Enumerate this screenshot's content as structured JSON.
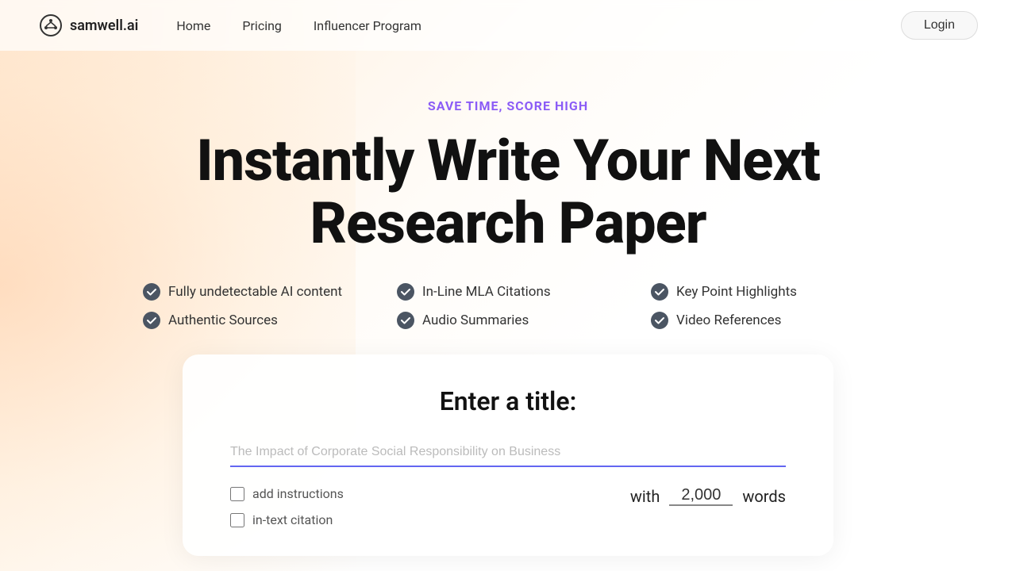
{
  "brand": {
    "name": "samwell.ai",
    "logo_alt": "samwell logo"
  },
  "nav": {
    "links": [
      {
        "label": "Home",
        "id": "home"
      },
      {
        "label": "Pricing",
        "id": "pricing"
      },
      {
        "label": "Influencer Program",
        "id": "influencer"
      }
    ],
    "login_label": "Login"
  },
  "hero": {
    "tagline": "SAVE TIME, SCORE HIGH",
    "title_line1": "Instantly Write Your Next",
    "title_line2": "Research Paper"
  },
  "features": [
    {
      "label": "Fully undetectable AI content",
      "id": "feat-undetectable"
    },
    {
      "label": "In-Line MLA Citations",
      "id": "feat-citations"
    },
    {
      "label": "Key Point Highlights",
      "id": "feat-highlights"
    },
    {
      "label": "Authentic Sources",
      "id": "feat-sources"
    },
    {
      "label": "Audio Summaries",
      "id": "feat-audio"
    },
    {
      "label": "Video References",
      "id": "feat-video"
    }
  ],
  "card": {
    "title": "Enter a title:",
    "input_placeholder": "The Impact of Corporate Social Responsibility on Business",
    "options": [
      {
        "label": "add instructions",
        "id": "opt-instructions"
      },
      {
        "label": "in-text citation",
        "id": "opt-citation"
      }
    ],
    "words_label_before": "with",
    "words_value": "2,000",
    "words_label_after": "words"
  }
}
